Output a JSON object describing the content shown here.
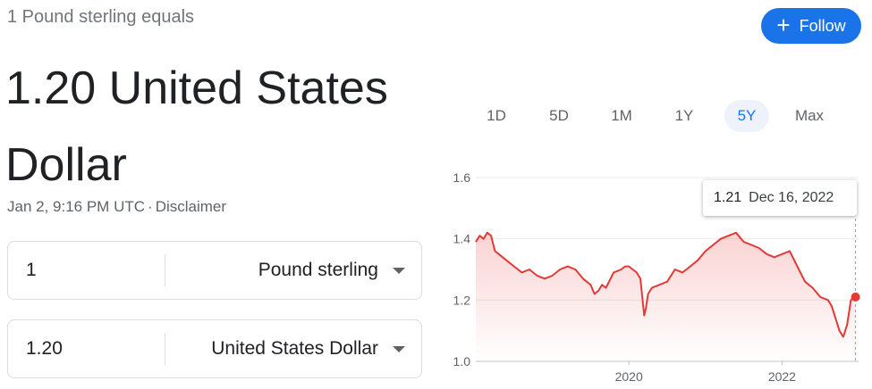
{
  "header": {
    "subtitle": "1 Pound sterling equals",
    "headline": "1.20 United States Dollar",
    "timestamp": "Jan 2, 9:16 PM UTC",
    "separator": "·",
    "disclaimer": "Disclaimer"
  },
  "follow_button": {
    "label": "Follow",
    "icon": "plus-icon",
    "color": "#1a73e8"
  },
  "converter": {
    "from": {
      "amount": "1",
      "unit": "Pound sterling"
    },
    "to": {
      "amount": "1.20",
      "unit": "United States Dollar"
    }
  },
  "ranges": [
    {
      "label": "1D",
      "active": false
    },
    {
      "label": "5D",
      "active": false
    },
    {
      "label": "1M",
      "active": false
    },
    {
      "label": "1Y",
      "active": false
    },
    {
      "label": "5Y",
      "active": true
    },
    {
      "label": "Max",
      "active": false
    }
  ],
  "tooltip": {
    "value": "1.21",
    "date": "Dec 16, 2022"
  },
  "chart_data": {
    "type": "area",
    "line_color": "#e53935",
    "ylim": [
      1.0,
      1.6
    ],
    "y_ticks": [
      "1.6",
      "1.4",
      "1.2",
      "1.0"
    ],
    "x_ticks": [
      "2020",
      "2022"
    ],
    "xlim": [
      2018.0,
      2023.0
    ],
    "grid": true,
    "series": [
      {
        "x": [
          2018.0,
          2018.05,
          2018.1,
          2018.15,
          2018.2,
          2018.25,
          2018.3,
          2018.35,
          2018.4,
          2018.5,
          2018.6,
          2018.7,
          2018.8,
          2018.9,
          2019.0,
          2019.1,
          2019.2,
          2019.3,
          2019.4,
          2019.5,
          2019.55,
          2019.6,
          2019.65,
          2019.7,
          2019.8,
          2019.9,
          2019.95,
          2020.0,
          2020.1,
          2020.15,
          2020.2,
          2020.22,
          2020.25,
          2020.3,
          2020.4,
          2020.5,
          2020.6,
          2020.7,
          2020.8,
          2020.9,
          2021.0,
          2021.1,
          2021.2,
          2021.3,
          2021.4,
          2021.5,
          2021.6,
          2021.7,
          2021.8,
          2021.9,
          2022.0,
          2022.1,
          2022.2,
          2022.3,
          2022.4,
          2022.5,
          2022.6,
          2022.65,
          2022.7,
          2022.75,
          2022.8,
          2022.85,
          2022.9,
          2022.96
        ],
        "y": [
          1.39,
          1.41,
          1.4,
          1.42,
          1.41,
          1.36,
          1.35,
          1.34,
          1.33,
          1.31,
          1.29,
          1.3,
          1.28,
          1.27,
          1.28,
          1.3,
          1.31,
          1.3,
          1.27,
          1.25,
          1.22,
          1.23,
          1.25,
          1.24,
          1.29,
          1.3,
          1.31,
          1.31,
          1.29,
          1.27,
          1.15,
          1.17,
          1.22,
          1.24,
          1.25,
          1.26,
          1.3,
          1.29,
          1.31,
          1.33,
          1.36,
          1.38,
          1.4,
          1.41,
          1.42,
          1.39,
          1.38,
          1.37,
          1.35,
          1.34,
          1.35,
          1.36,
          1.31,
          1.26,
          1.24,
          1.21,
          1.2,
          1.18,
          1.14,
          1.1,
          1.08,
          1.12,
          1.2,
          1.21
        ]
      }
    ],
    "highlight": {
      "x": 2022.96,
      "y": 1.21
    }
  }
}
